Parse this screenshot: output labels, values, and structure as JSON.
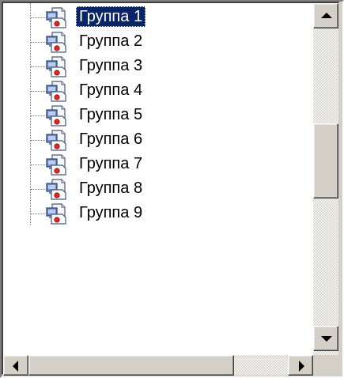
{
  "tree": {
    "items": [
      {
        "label": "Группа 1",
        "selected": true
      },
      {
        "label": "Группа 2",
        "selected": false
      },
      {
        "label": "Группа 3",
        "selected": false
      },
      {
        "label": "Группа 4",
        "selected": false
      },
      {
        "label": "Группа 5",
        "selected": false
      },
      {
        "label": "Группа 6",
        "selected": false
      },
      {
        "label": "Группа 7",
        "selected": false
      },
      {
        "label": "Группа 8",
        "selected": false
      },
      {
        "label": "Группа 9",
        "selected": false
      }
    ],
    "item_icon": "group-document-icon"
  },
  "scrollbars": {
    "vertical": {
      "position": 0.42
    },
    "horizontal": {
      "position": 0.0
    }
  },
  "colors": {
    "selection_bg": "#0a246a",
    "selection_fg": "#ffffff",
    "face": "#d4d0c8"
  }
}
